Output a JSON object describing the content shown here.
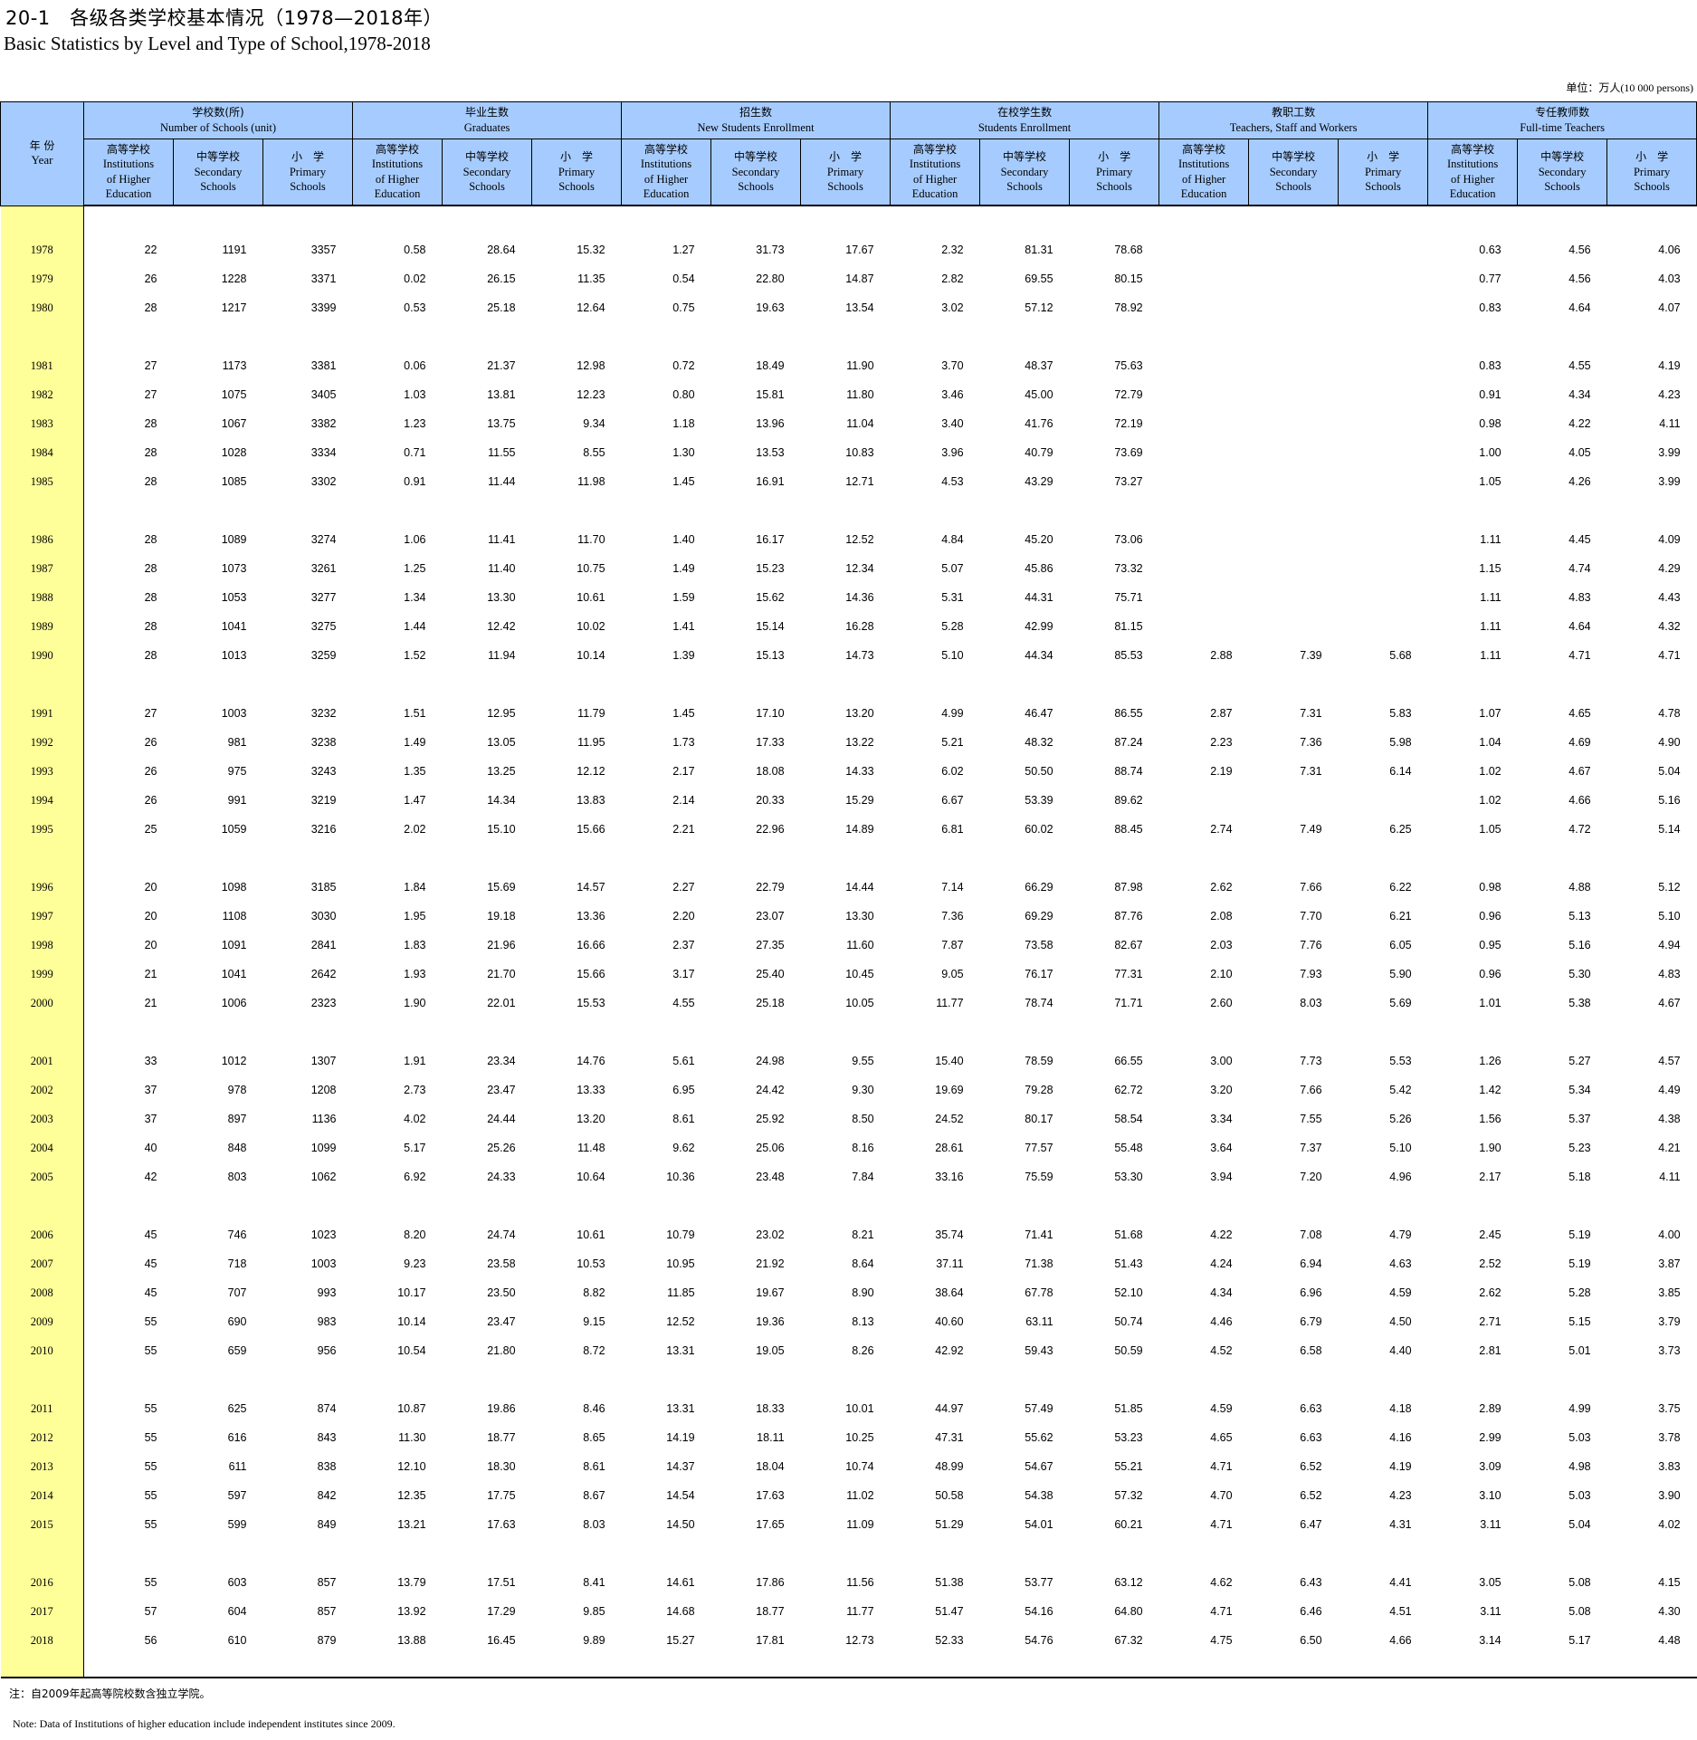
{
  "title_cn": "20-1　各级各类学校基本情况（1978—2018年）",
  "title_en": "Basic Statistics by Level and Type of School,1978-2018",
  "unit_cn": "单位：万人",
  "unit_en": "(10 000 persons)",
  "header": {
    "year_cn": "年 份",
    "year_en": "Year",
    "groups": [
      {
        "cn": "学校数(所)",
        "en": "Number of Schools (unit)"
      },
      {
        "cn": "毕业生数",
        "en": "Graduates"
      },
      {
        "cn": "招生数",
        "en": "New Students Enrollment"
      },
      {
        "cn": "在校学生数",
        "en": "Students Enrollment"
      },
      {
        "cn": "教职工数",
        "en": "Teachers, Staff and Workers"
      },
      {
        "cn": "专任教师数",
        "en": "Full-time Teachers"
      }
    ],
    "sub": [
      {
        "cn": "高等学校",
        "en1": "Institutions",
        "en2": "of Higher",
        "en3": "Education"
      },
      {
        "cn": "中等学校",
        "en1": "Secondary",
        "en2": "Schools",
        "en3": ""
      },
      {
        "cn": "小　学",
        "en1": "Primary",
        "en2": "Schools",
        "en3": ""
      }
    ]
  },
  "row_groups": [
    [
      {
        "year": "1978",
        "v": [
          "22",
          "1191",
          "3357",
          "0.58",
          "28.64",
          "15.32",
          "1.27",
          "31.73",
          "17.67",
          "2.32",
          "81.31",
          "78.68",
          "",
          "",
          "",
          "0.63",
          "4.56",
          "4.06"
        ]
      },
      {
        "year": "1979",
        "v": [
          "26",
          "1228",
          "3371",
          "0.02",
          "26.15",
          "11.35",
          "0.54",
          "22.80",
          "14.87",
          "2.82",
          "69.55",
          "80.15",
          "",
          "",
          "",
          "0.77",
          "4.56",
          "4.03"
        ]
      },
      {
        "year": "1980",
        "v": [
          "28",
          "1217",
          "3399",
          "0.53",
          "25.18",
          "12.64",
          "0.75",
          "19.63",
          "13.54",
          "3.02",
          "57.12",
          "78.92",
          "",
          "",
          "",
          "0.83",
          "4.64",
          "4.07"
        ]
      }
    ],
    [
      {
        "year": "1981",
        "v": [
          "27",
          "1173",
          "3381",
          "0.06",
          "21.37",
          "12.98",
          "0.72",
          "18.49",
          "11.90",
          "3.70",
          "48.37",
          "75.63",
          "",
          "",
          "",
          "0.83",
          "4.55",
          "4.19"
        ]
      },
      {
        "year": "1982",
        "v": [
          "27",
          "1075",
          "3405",
          "1.03",
          "13.81",
          "12.23",
          "0.80",
          "15.81",
          "11.80",
          "3.46",
          "45.00",
          "72.79",
          "",
          "",
          "",
          "0.91",
          "4.34",
          "4.23"
        ]
      },
      {
        "year": "1983",
        "v": [
          "28",
          "1067",
          "3382",
          "1.23",
          "13.75",
          "9.34",
          "1.18",
          "13.96",
          "11.04",
          "3.40",
          "41.76",
          "72.19",
          "",
          "",
          "",
          "0.98",
          "4.22",
          "4.11"
        ]
      },
      {
        "year": "1984",
        "v": [
          "28",
          "1028",
          "3334",
          "0.71",
          "11.55",
          "8.55",
          "1.30",
          "13.53",
          "10.83",
          "3.96",
          "40.79",
          "73.69",
          "",
          "",
          "",
          "1.00",
          "4.05",
          "3.99"
        ]
      },
      {
        "year": "1985",
        "v": [
          "28",
          "1085",
          "3302",
          "0.91",
          "11.44",
          "11.98",
          "1.45",
          "16.91",
          "12.71",
          "4.53",
          "43.29",
          "73.27",
          "",
          "",
          "",
          "1.05",
          "4.26",
          "3.99"
        ]
      }
    ],
    [
      {
        "year": "1986",
        "v": [
          "28",
          "1089",
          "3274",
          "1.06",
          "11.41",
          "11.70",
          "1.40",
          "16.17",
          "12.52",
          "4.84",
          "45.20",
          "73.06",
          "",
          "",
          "",
          "1.11",
          "4.45",
          "4.09"
        ]
      },
      {
        "year": "1987",
        "v": [
          "28",
          "1073",
          "3261",
          "1.25",
          "11.40",
          "10.75",
          "1.49",
          "15.23",
          "12.34",
          "5.07",
          "45.86",
          "73.32",
          "",
          "",
          "",
          "1.15",
          "4.74",
          "4.29"
        ]
      },
      {
        "year": "1988",
        "v": [
          "28",
          "1053",
          "3277",
          "1.34",
          "13.30",
          "10.61",
          "1.59",
          "15.62",
          "14.36",
          "5.31",
          "44.31",
          "75.71",
          "",
          "",
          "",
          "1.11",
          "4.83",
          "4.43"
        ]
      },
      {
        "year": "1989",
        "v": [
          "28",
          "1041",
          "3275",
          "1.44",
          "12.42",
          "10.02",
          "1.41",
          "15.14",
          "16.28",
          "5.28",
          "42.99",
          "81.15",
          "",
          "",
          "",
          "1.11",
          "4.64",
          "4.32"
        ]
      },
      {
        "year": "1990",
        "v": [
          "28",
          "1013",
          "3259",
          "1.52",
          "11.94",
          "10.14",
          "1.39",
          "15.13",
          "14.73",
          "5.10",
          "44.34",
          "85.53",
          "2.88",
          "7.39",
          "5.68",
          "1.11",
          "4.71",
          "4.71"
        ]
      }
    ],
    [
      {
        "year": "1991",
        "v": [
          "27",
          "1003",
          "3232",
          "1.51",
          "12.95",
          "11.79",
          "1.45",
          "17.10",
          "13.20",
          "4.99",
          "46.47",
          "86.55",
          "2.87",
          "7.31",
          "5.83",
          "1.07",
          "4.65",
          "4.78"
        ]
      },
      {
        "year": "1992",
        "v": [
          "26",
          "981",
          "3238",
          "1.49",
          "13.05",
          "11.95",
          "1.73",
          "17.33",
          "13.22",
          "5.21",
          "48.32",
          "87.24",
          "2.23",
          "7.36",
          "5.98",
          "1.04",
          "4.69",
          "4.90"
        ]
      },
      {
        "year": "1993",
        "v": [
          "26",
          "975",
          "3243",
          "1.35",
          "13.25",
          "12.12",
          "2.17",
          "18.08",
          "14.33",
          "6.02",
          "50.50",
          "88.74",
          "2.19",
          "7.31",
          "6.14",
          "1.02",
          "4.67",
          "5.04"
        ]
      },
      {
        "year": "1994",
        "v": [
          "26",
          "991",
          "3219",
          "1.47",
          "14.34",
          "13.83",
          "2.14",
          "20.33",
          "15.29",
          "6.67",
          "53.39",
          "89.62",
          "",
          "",
          "",
          "1.02",
          "4.66",
          "5.16"
        ]
      },
      {
        "year": "1995",
        "v": [
          "25",
          "1059",
          "3216",
          "2.02",
          "15.10",
          "15.66",
          "2.21",
          "22.96",
          "14.89",
          "6.81",
          "60.02",
          "88.45",
          "2.74",
          "7.49",
          "6.25",
          "1.05",
          "4.72",
          "5.14"
        ]
      }
    ],
    [
      {
        "year": "1996",
        "v": [
          "20",
          "1098",
          "3185",
          "1.84",
          "15.69",
          "14.57",
          "2.27",
          "22.79",
          "14.44",
          "7.14",
          "66.29",
          "87.98",
          "2.62",
          "7.66",
          "6.22",
          "0.98",
          "4.88",
          "5.12"
        ]
      },
      {
        "year": "1997",
        "v": [
          "20",
          "1108",
          "3030",
          "1.95",
          "19.18",
          "13.36",
          "2.20",
          "23.07",
          "13.30",
          "7.36",
          "69.29",
          "87.76",
          "2.08",
          "7.70",
          "6.21",
          "0.96",
          "5.13",
          "5.10"
        ]
      },
      {
        "year": "1998",
        "v": [
          "20",
          "1091",
          "2841",
          "1.83",
          "21.96",
          "16.66",
          "2.37",
          "27.35",
          "11.60",
          "7.87",
          "73.58",
          "82.67",
          "2.03",
          "7.76",
          "6.05",
          "0.95",
          "5.16",
          "4.94"
        ]
      },
      {
        "year": "1999",
        "v": [
          "21",
          "1041",
          "2642",
          "1.93",
          "21.70",
          "15.66",
          "3.17",
          "25.40",
          "10.45",
          "9.05",
          "76.17",
          "77.31",
          "2.10",
          "7.93",
          "5.90",
          "0.96",
          "5.30",
          "4.83"
        ]
      },
      {
        "year": "2000",
        "v": [
          "21",
          "1006",
          "2323",
          "1.90",
          "22.01",
          "15.53",
          "4.55",
          "25.18",
          "10.05",
          "11.77",
          "78.74",
          "71.71",
          "2.60",
          "8.03",
          "5.69",
          "1.01",
          "5.38",
          "4.67"
        ]
      }
    ],
    [
      {
        "year": "2001",
        "v": [
          "33",
          "1012",
          "1307",
          "1.91",
          "23.34",
          "14.76",
          "5.61",
          "24.98",
          "9.55",
          "15.40",
          "78.59",
          "66.55",
          "3.00",
          "7.73",
          "5.53",
          "1.26",
          "5.27",
          "4.57"
        ]
      },
      {
        "year": "2002",
        "v": [
          "37",
          "978",
          "1208",
          "2.73",
          "23.47",
          "13.33",
          "6.95",
          "24.42",
          "9.30",
          "19.69",
          "79.28",
          "62.72",
          "3.20",
          "7.66",
          "5.42",
          "1.42",
          "5.34",
          "4.49"
        ]
      },
      {
        "year": "2003",
        "v": [
          "37",
          "897",
          "1136",
          "4.02",
          "24.44",
          "13.20",
          "8.61",
          "25.92",
          "8.50",
          "24.52",
          "80.17",
          "58.54",
          "3.34",
          "7.55",
          "5.26",
          "1.56",
          "5.37",
          "4.38"
        ]
      },
      {
        "year": "2004",
        "v": [
          "40",
          "848",
          "1099",
          "5.17",
          "25.26",
          "11.48",
          "9.62",
          "25.06",
          "8.16",
          "28.61",
          "77.57",
          "55.48",
          "3.64",
          "7.37",
          "5.10",
          "1.90",
          "5.23",
          "4.21"
        ]
      },
      {
        "year": "2005",
        "v": [
          "42",
          "803",
          "1062",
          "6.92",
          "24.33",
          "10.64",
          "10.36",
          "23.48",
          "7.84",
          "33.16",
          "75.59",
          "53.30",
          "3.94",
          "7.20",
          "4.96",
          "2.17",
          "5.18",
          "4.11"
        ]
      }
    ],
    [
      {
        "year": "2006",
        "v": [
          "45",
          "746",
          "1023",
          "8.20",
          "24.74",
          "10.61",
          "10.79",
          "23.02",
          "8.21",
          "35.74",
          "71.41",
          "51.68",
          "4.22",
          "7.08",
          "4.79",
          "2.45",
          "5.19",
          "4.00"
        ]
      },
      {
        "year": "2007",
        "v": [
          "45",
          "718",
          "1003",
          "9.23",
          "23.58",
          "10.53",
          "10.95",
          "21.92",
          "8.64",
          "37.11",
          "71.38",
          "51.43",
          "4.24",
          "6.94",
          "4.63",
          "2.52",
          "5.19",
          "3.87"
        ]
      },
      {
        "year": "2008",
        "v": [
          "45",
          "707",
          "993",
          "10.17",
          "23.50",
          "8.82",
          "11.85",
          "19.67",
          "8.90",
          "38.64",
          "67.78",
          "52.10",
          "4.34",
          "6.96",
          "4.59",
          "2.62",
          "5.28",
          "3.85"
        ]
      },
      {
        "year": "2009",
        "v": [
          "55",
          "690",
          "983",
          "10.14",
          "23.47",
          "9.15",
          "12.52",
          "19.36",
          "8.13",
          "40.60",
          "63.11",
          "50.74",
          "4.46",
          "6.79",
          "4.50",
          "2.71",
          "5.15",
          "3.79"
        ]
      },
      {
        "year": "2010",
        "v": [
          "55",
          "659",
          "956",
          "10.54",
          "21.80",
          "8.72",
          "13.31",
          "19.05",
          "8.26",
          "42.92",
          "59.43",
          "50.59",
          "4.52",
          "6.58",
          "4.40",
          "2.81",
          "5.01",
          "3.73"
        ]
      }
    ],
    [
      {
        "year": "2011",
        "v": [
          "55",
          "625",
          "874",
          "10.87",
          "19.86",
          "8.46",
          "13.31",
          "18.33",
          "10.01",
          "44.97",
          "57.49",
          "51.85",
          "4.59",
          "6.63",
          "4.18",
          "2.89",
          "4.99",
          "3.75"
        ]
      },
      {
        "year": "2012",
        "v": [
          "55",
          "616",
          "843",
          "11.30",
          "18.77",
          "8.65",
          "14.19",
          "18.11",
          "10.25",
          "47.31",
          "55.62",
          "53.23",
          "4.65",
          "6.63",
          "4.16",
          "2.99",
          "5.03",
          "3.78"
        ]
      },
      {
        "year": "2013",
        "v": [
          "55",
          "611",
          "838",
          "12.10",
          "18.30",
          "8.61",
          "14.37",
          "18.04",
          "10.74",
          "48.99",
          "54.67",
          "55.21",
          "4.71",
          "6.52",
          "4.19",
          "3.09",
          "4.98",
          "3.83"
        ]
      },
      {
        "year": "2014",
        "v": [
          "55",
          "597",
          "842",
          "12.35",
          "17.75",
          "8.67",
          "14.54",
          "17.63",
          "11.02",
          "50.58",
          "54.38",
          "57.32",
          "4.70",
          "6.52",
          "4.23",
          "3.10",
          "5.03",
          "3.90"
        ]
      },
      {
        "year": "2015",
        "v": [
          "55",
          "599",
          "849",
          "13.21",
          "17.63",
          "8.03",
          "14.50",
          "17.65",
          "11.09",
          "51.29",
          "54.01",
          "60.21",
          "4.71",
          "6.47",
          "4.31",
          "3.11",
          "5.04",
          "4.02"
        ]
      }
    ],
    [
      {
        "year": "2016",
        "v": [
          "55",
          "603",
          "857",
          "13.79",
          "17.51",
          "8.41",
          "14.61",
          "17.86",
          "11.56",
          "51.38",
          "53.77",
          "63.12",
          "4.62",
          "6.43",
          "4.41",
          "3.05",
          "5.08",
          "4.15"
        ]
      },
      {
        "year": "2017",
        "v": [
          "57",
          "604",
          "857",
          "13.92",
          "17.29",
          "9.85",
          "14.68",
          "18.77",
          "11.77",
          "51.47",
          "54.16",
          "64.80",
          "4.71",
          "6.46",
          "4.51",
          "3.11",
          "5.08",
          "4.30"
        ]
      },
      {
        "year": "2018",
        "v": [
          "56",
          "610",
          "879",
          "13.88",
          "16.45",
          "9.89",
          "15.27",
          "17.81",
          "12.73",
          "52.33",
          "54.76",
          "67.32",
          "4.75",
          "6.50",
          "4.66",
          "3.14",
          "5.17",
          "4.48"
        ]
      }
    ]
  ],
  "note_cn": "注：自2009年起高等院校数含独立学院。",
  "note_en": "Note: Data of Institutions of higher education include independent institutes since 2009."
}
